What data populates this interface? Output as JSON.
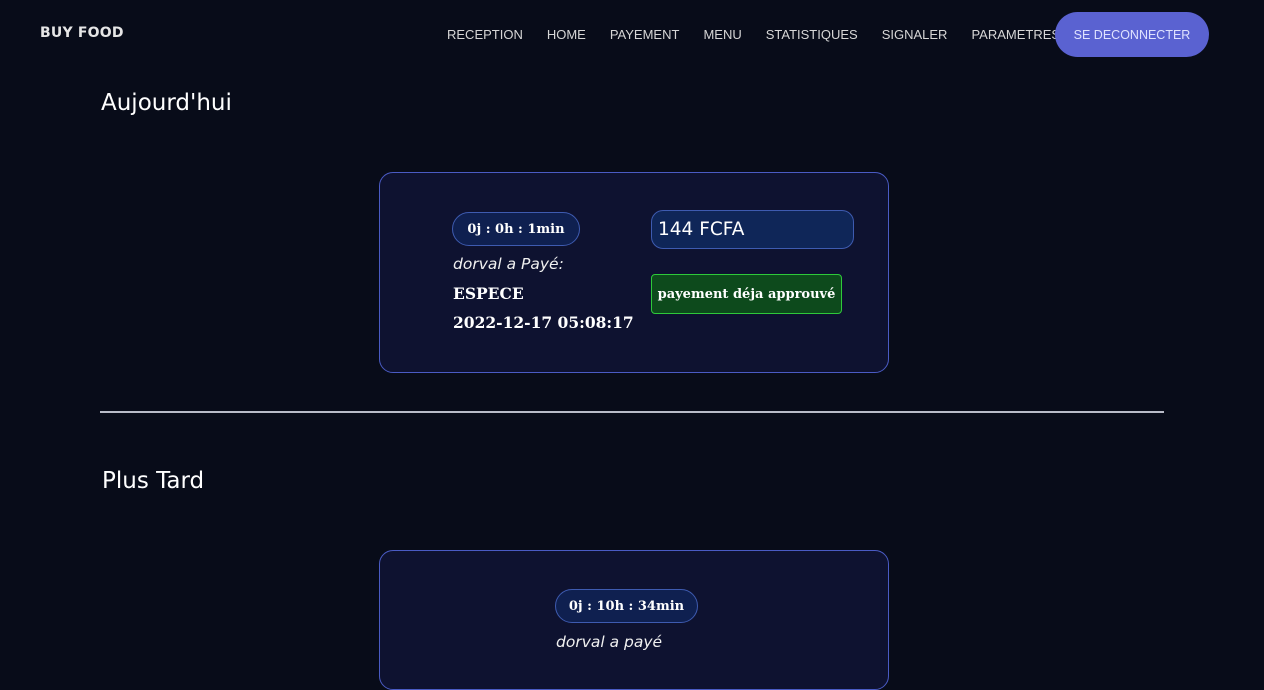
{
  "navbar": {
    "brand": "BUY FOOD",
    "links": [
      "RECEPTION",
      "HOME",
      "PAYEMENT",
      "MENU",
      "STATISTIQUES",
      "SIGNALER",
      "PARAMETRES"
    ],
    "logout_label": "SE DECONNECTER"
  },
  "today": {
    "title": "Aujourd'hui",
    "card": {
      "elapsed": "0j : 0h : 1min",
      "payer": "dorval a Payé:",
      "method": "ESPECE",
      "datetime": "2022-12-17 05:08:17",
      "amount": "144 FCFA",
      "status": "payement déja approuvé"
    }
  },
  "later": {
    "title": "Plus Tard",
    "card": {
      "elapsed": "0j : 10h : 34min",
      "payer": "dorval a payé"
    }
  },
  "colors": {
    "background": "#080c19",
    "accent": "#5a62d1",
    "card_border": "#4a5bc4",
    "approved_green": "#2ec93a"
  }
}
